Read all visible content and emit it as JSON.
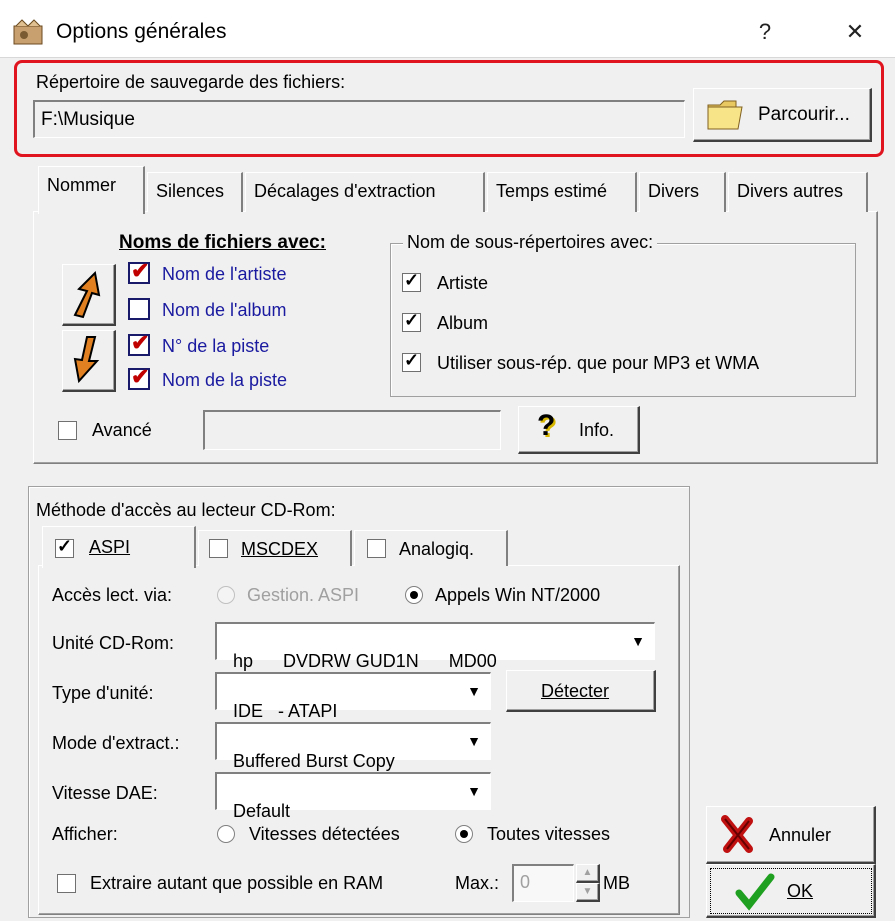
{
  "window": {
    "title": "Options générales",
    "help_btn": "?",
    "close_btn": "✕"
  },
  "save": {
    "label": "Répertoire de sauvegarde des fichiers:",
    "path": "F:\\Musique",
    "browse_btn": "Parcourir..."
  },
  "tabs": [
    {
      "label": "Nommer",
      "active": true
    },
    {
      "label": "Silences"
    },
    {
      "label": "Décalages d'extraction"
    },
    {
      "label": "Temps estimé"
    },
    {
      "label": "Divers"
    },
    {
      "label": "Divers autres"
    }
  ],
  "naming": {
    "heading": "Noms de fichiers avec:",
    "items": [
      {
        "label": "Nom de l'artiste",
        "checked": true
      },
      {
        "label": "Nom de l'album",
        "checked": false
      },
      {
        "label": "N° de la piste",
        "checked": true
      },
      {
        "label": "Nom de la piste",
        "checked": true
      }
    ],
    "subdir_legend": "Nom de sous-répertoires avec:",
    "subdir_items": [
      {
        "label": "Artiste",
        "checked": true
      },
      {
        "label": "Album",
        "checked": true
      },
      {
        "label": "Utiliser sous-rép. que pour MP3 et WMA",
        "checked": true
      }
    ],
    "advanced_label": "Avancé",
    "advanced_value": "",
    "info_btn": "Info."
  },
  "cdrom": {
    "legend": "Méthode d'accès au lecteur CD-Rom:",
    "tabs": [
      {
        "label": "ASPI",
        "checked": true
      },
      {
        "label": "MSCDEX",
        "checked": false
      },
      {
        "label": "Analogiq.",
        "checked": false
      }
    ],
    "access_label": "Accès lect. via:",
    "access_opt1": "Gestion. ASPI",
    "access_opt2": "Appels Win NT/2000",
    "drive_label": "Unité CD-Rom:",
    "drive_value": "hp      DVDRW GUD1N      MD00",
    "type_label": "Type d'unité:",
    "type_value": "IDE   - ATAPI",
    "detect_btn": "Détecter",
    "mode_label": "Mode d'extract.:",
    "mode_value": "Buffered Burst Copy",
    "speed_label": "Vitesse DAE:",
    "speed_value": "Default",
    "show_label": "Afficher:",
    "show_opt1": "Vitesses détectées",
    "show_opt2": "Toutes vitesses",
    "ram_label": "Extraire autant que possible en RAM",
    "max_label": "Max.:",
    "max_value": "0",
    "mb_label": "MB"
  },
  "buttons": {
    "cancel": "Annuler",
    "ok": "OK"
  }
}
